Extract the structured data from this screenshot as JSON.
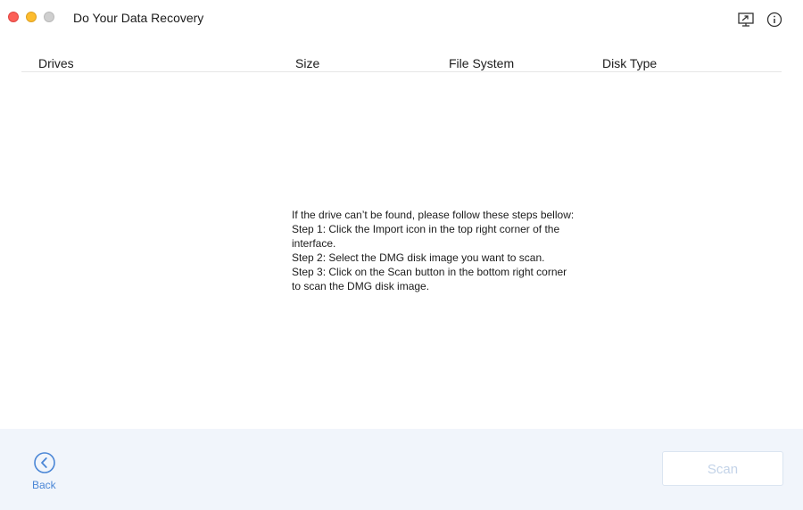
{
  "app": {
    "title": "Do Your Data Recovery"
  },
  "toolbar": {
    "import_icon": "import-icon",
    "info_icon": "info-icon"
  },
  "table": {
    "columns": [
      "Drives",
      "Size",
      "File System",
      "Disk Type"
    ],
    "rows": []
  },
  "help": {
    "lines": [
      "If the drive can’t be found, please follow these steps bellow:",
      "Step 1: Click the Import icon in the top right corner of the",
      "interface.",
      "Step 2: Select the DMG disk image you want to scan.",
      "Step 3: Click on the Scan button in the bottom right corner",
      "to scan the DMG disk image."
    ]
  },
  "footer": {
    "back_label": "Back",
    "scan_label": "Scan",
    "scan_enabled": false
  },
  "colors": {
    "accent": "#4a86d6",
    "footer_bg": "#f1f5fb",
    "disabled_text": "#c3d3e8"
  }
}
